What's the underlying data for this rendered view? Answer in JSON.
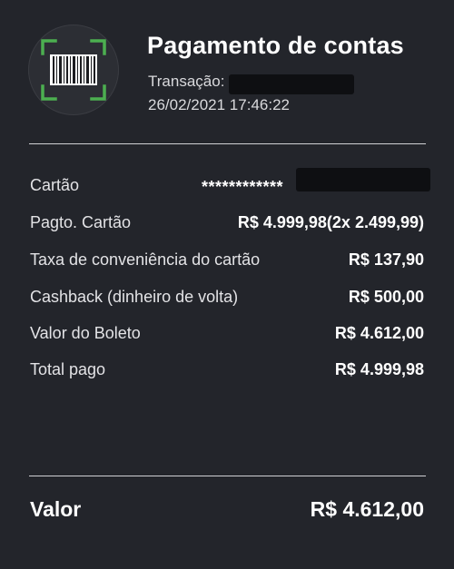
{
  "header": {
    "icon": "barcode-scan-icon",
    "title": "Pagamento de contas",
    "transaction_label": "Transação:",
    "datetime": "26/02/2021 17:46:22"
  },
  "details": {
    "card": {
      "label": "Cartão",
      "value": "************"
    },
    "card_payment": {
      "label": "Pagto. Cartão",
      "value": "R$ 4.999,98(2x 2.499,99)"
    },
    "fee": {
      "label": "Taxa de conveniência do cartão",
      "value": "R$ 137,90"
    },
    "cashback": {
      "label": "Cashback (dinheiro de volta)",
      "value": "R$ 500,00"
    },
    "bill_value": {
      "label": "Valor do Boleto",
      "value": "R$ 4.612,00"
    },
    "total_paid": {
      "label": "Total pago",
      "value": "R$ 4.999,98"
    }
  },
  "summary": {
    "label": "Valor",
    "value": "R$ 4.612,00"
  },
  "colors": {
    "background": "#23252b",
    "accent_green": "#4caf50",
    "text": "#ffffff"
  }
}
